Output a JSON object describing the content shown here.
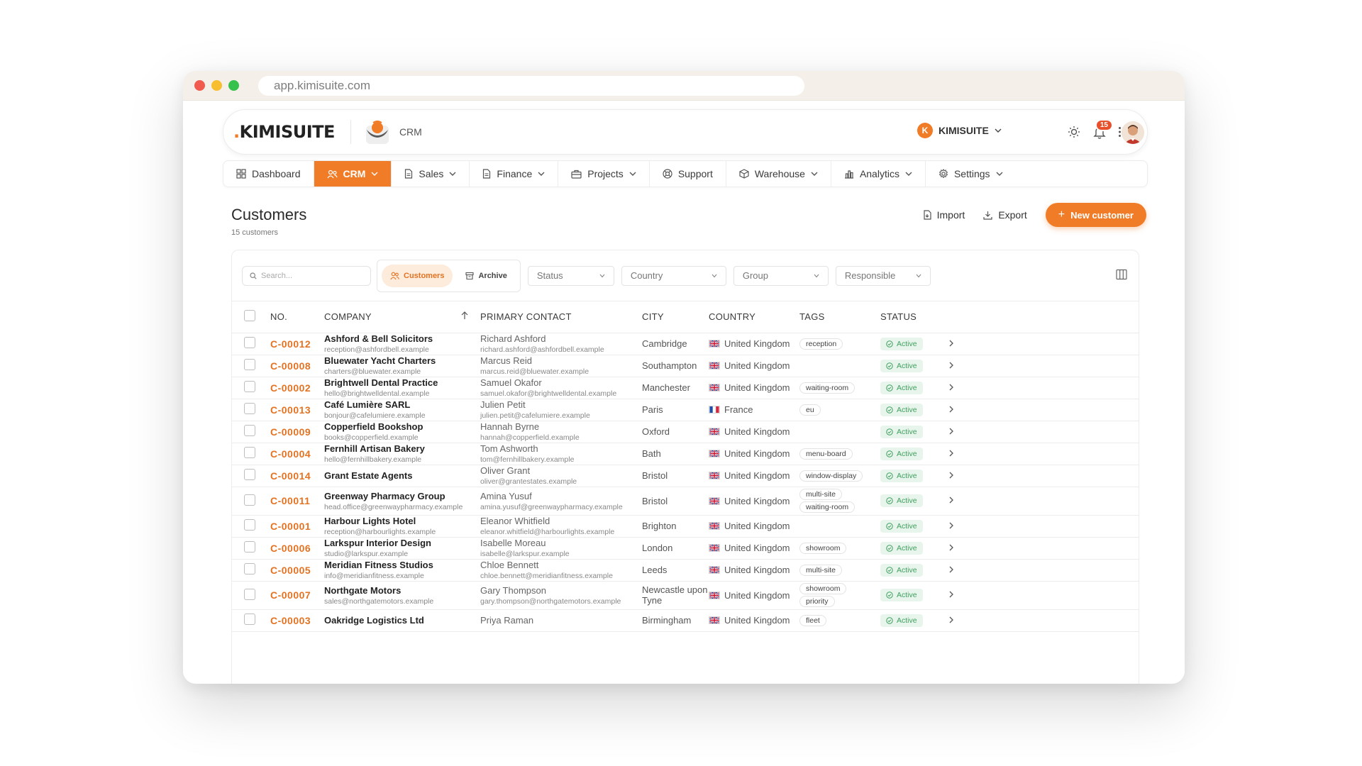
{
  "browser": {
    "url": "app.kimisuite.com"
  },
  "header": {
    "logo_dot": ".",
    "logo_text": "KIMISUITE",
    "app_name": "CRM",
    "org_initial": "K",
    "org_name": "KIMISUITE",
    "notification_count": "15"
  },
  "nav": [
    {
      "label": "Dashboard",
      "icon": "grid-icon",
      "dropdown": false,
      "active": false
    },
    {
      "label": "CRM",
      "icon": "users-icon",
      "dropdown": true,
      "active": true
    },
    {
      "label": "Sales",
      "icon": "document-icon",
      "dropdown": true,
      "active": false
    },
    {
      "label": "Finance",
      "icon": "document-icon",
      "dropdown": true,
      "active": false
    },
    {
      "label": "Projects",
      "icon": "briefcase-icon",
      "dropdown": true,
      "active": false
    },
    {
      "label": "Support",
      "icon": "lifebuoy-icon",
      "dropdown": false,
      "active": false
    },
    {
      "label": "Warehouse",
      "icon": "box-icon",
      "dropdown": true,
      "active": false
    },
    {
      "label": "Analytics",
      "icon": "bar-chart-icon",
      "dropdown": true,
      "active": false
    },
    {
      "label": "Settings",
      "icon": "gear-icon",
      "dropdown": true,
      "active": false
    }
  ],
  "page": {
    "title": "Customers",
    "count": "15 customers",
    "import_label": "Import",
    "export_label": "Export",
    "new_label": "New customer"
  },
  "filters": {
    "search_placeholder": "Search...",
    "tab_customers": "Customers",
    "tab_archive": "Archive",
    "status": "Status",
    "country": "Country",
    "group": "Group",
    "responsible": "Responsible"
  },
  "table": {
    "headers": {
      "no": "NO.",
      "company": "COMPANY",
      "contact": "PRIMARY CONTACT",
      "city": "CITY",
      "country": "COUNTRY",
      "tags": "TAGS",
      "status": "STATUS"
    },
    "rows": [
      {
        "no": "C-00012",
        "company": "Ashford & Bell Solicitors",
        "company_email": "reception@ashfordbell.example",
        "contact": "Richard Ashford",
        "contact_email": "richard.ashford@ashfordbell.example",
        "city": "Cambridge",
        "country": "United Kingdom",
        "flag": "uk",
        "tags": [
          "reception"
        ],
        "status": "Active"
      },
      {
        "no": "C-00008",
        "company": "Bluewater Yacht Charters",
        "company_email": "charters@bluewater.example",
        "contact": "Marcus Reid",
        "contact_email": "marcus.reid@bluewater.example",
        "city": "Southampton",
        "country": "United Kingdom",
        "flag": "uk",
        "tags": [],
        "status": "Active"
      },
      {
        "no": "C-00002",
        "company": "Brightwell Dental Practice",
        "company_email": "hello@brightwelldental.example",
        "contact": "Samuel Okafor",
        "contact_email": "samuel.okafor@brightwelldental.example",
        "city": "Manchester",
        "country": "United Kingdom",
        "flag": "uk",
        "tags": [
          "waiting-room"
        ],
        "status": "Active"
      },
      {
        "no": "C-00013",
        "company": "Café Lumière SARL",
        "company_email": "bonjour@cafelumiere.example",
        "contact": "Julien Petit",
        "contact_email": "julien.petit@cafelumiere.example",
        "city": "Paris",
        "country": "France",
        "flag": "fr",
        "tags": [
          "eu"
        ],
        "status": "Active"
      },
      {
        "no": "C-00009",
        "company": "Copperfield Bookshop",
        "company_email": "books@copperfield.example",
        "contact": "Hannah Byrne",
        "contact_email": "hannah@copperfield.example",
        "city": "Oxford",
        "country": "United Kingdom",
        "flag": "uk",
        "tags": [],
        "status": "Active"
      },
      {
        "no": "C-00004",
        "company": "Fernhill Artisan Bakery",
        "company_email": "hello@fernhillbakery.example",
        "contact": "Tom Ashworth",
        "contact_email": "tom@fernhillbakery.example",
        "city": "Bath",
        "country": "United Kingdom",
        "flag": "uk",
        "tags": [
          "menu-board"
        ],
        "status": "Active"
      },
      {
        "no": "C-00014",
        "company": "Grant Estate Agents",
        "company_email": "",
        "contact": "Oliver Grant",
        "contact_email": "oliver@grantestates.example",
        "city": "Bristol",
        "country": "United Kingdom",
        "flag": "uk",
        "tags": [
          "window-display"
        ],
        "status": "Active"
      },
      {
        "no": "C-00011",
        "company": "Greenway Pharmacy Group",
        "company_email": "head.office@greenwaypharmacy.example",
        "contact": "Amina Yusuf",
        "contact_email": "amina.yusuf@greenwaypharmacy.example",
        "city": "Bristol",
        "country": "United Kingdom",
        "flag": "uk",
        "tags": [
          "multi-site",
          "waiting-room"
        ],
        "status": "Active"
      },
      {
        "no": "C-00001",
        "company": "Harbour Lights Hotel",
        "company_email": "reception@harbourlights.example",
        "contact": "Eleanor Whitfield",
        "contact_email": "eleanor.whitfield@harbourlights.example",
        "city": "Brighton",
        "country": "United Kingdom",
        "flag": "uk",
        "tags": [],
        "status": "Active"
      },
      {
        "no": "C-00006",
        "company": "Larkspur Interior Design",
        "company_email": "studio@larkspur.example",
        "contact": "Isabelle Moreau",
        "contact_email": "isabelle@larkspur.example",
        "city": "London",
        "country": "United Kingdom",
        "flag": "uk",
        "tags": [
          "showroom"
        ],
        "status": "Active"
      },
      {
        "no": "C-00005",
        "company": "Meridian Fitness Studios",
        "company_email": "info@meridianfitness.example",
        "contact": "Chloe Bennett",
        "contact_email": "chloe.bennett@meridianfitness.example",
        "city": "Leeds",
        "country": "United Kingdom",
        "flag": "uk",
        "tags": [
          "multi-site"
        ],
        "status": "Active"
      },
      {
        "no": "C-00007",
        "company": "Northgate Motors",
        "company_email": "sales@northgatemotors.example",
        "contact": "Gary Thompson",
        "contact_email": "gary.thompson@northgatemotors.example",
        "city": "Newcastle upon Tyne",
        "country": "United Kingdom",
        "flag": "uk",
        "tags": [
          "showroom",
          "priority"
        ],
        "status": "Active"
      },
      {
        "no": "C-00003",
        "company": "Oakridge Logistics Ltd",
        "company_email": "",
        "contact": "Priya Raman",
        "contact_email": "",
        "city": "Birmingham",
        "country": "United Kingdom",
        "flag": "uk",
        "tags": [
          "fleet"
        ],
        "status": "Active"
      }
    ]
  },
  "colors": {
    "accent": "#f07c28",
    "active_green": "#3f9f5e"
  }
}
